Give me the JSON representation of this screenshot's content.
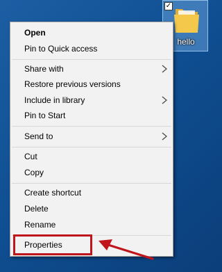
{
  "desktop": {
    "icon_label": "hello",
    "checkbox_mark": "✓"
  },
  "menu": {
    "items": [
      {
        "label": "Open"
      },
      {
        "label": "Pin to Quick access"
      },
      {
        "label": "Share with"
      },
      {
        "label": "Restore previous versions"
      },
      {
        "label": "Include in library"
      },
      {
        "label": "Pin to Start"
      },
      {
        "label": "Send to"
      },
      {
        "label": "Cut"
      },
      {
        "label": "Copy"
      },
      {
        "label": "Create shortcut"
      },
      {
        "label": "Delete"
      },
      {
        "label": "Rename"
      },
      {
        "label": "Properties"
      }
    ]
  },
  "colors": {
    "desktop_bg": "#1565a8",
    "menu_bg": "#f2f2f2",
    "annotation_red": "#c0151b",
    "folder_yellow": "#f3c84b"
  },
  "icons": [
    "folder-icon",
    "checkbox-icon",
    "chevron-right-icon",
    "arrow-icon"
  ]
}
